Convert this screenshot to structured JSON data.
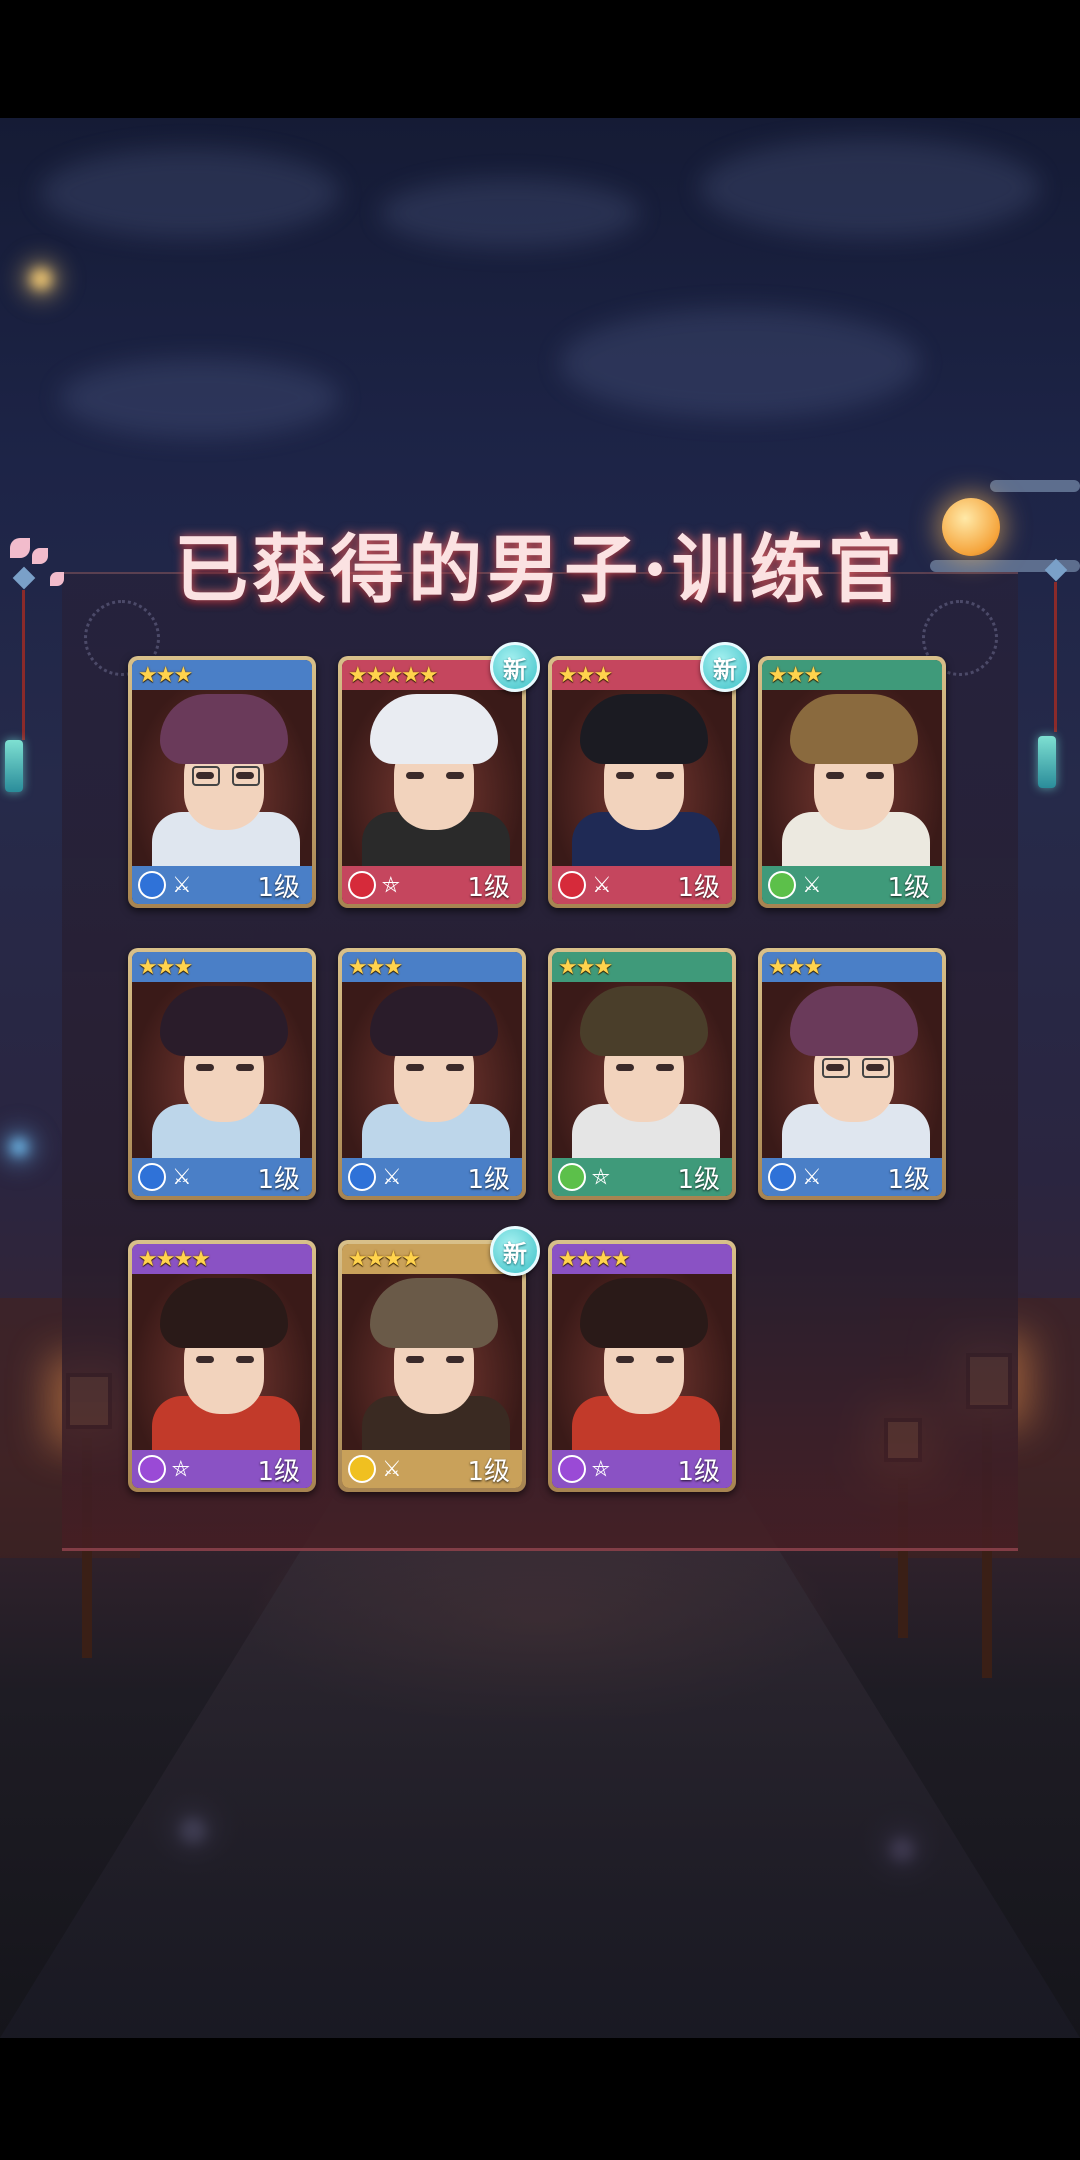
{
  "title": "已获得的男子·训练官",
  "new_badge_label": "新",
  "colors": {
    "blue": "#4a7fc7",
    "red": "#c5465e",
    "green": "#3f9a7a",
    "purple": "#8a52c4",
    "gold": "#c9a15a"
  },
  "cards": [
    {
      "stars": "★★★",
      "level": "1级",
      "frame": "blue",
      "attribute_icon": "water-orb-icon",
      "type_icon": "crossed-swords-icon",
      "is_new": false
    },
    {
      "stars": "★★★★★",
      "level": "1级",
      "frame": "red",
      "attribute_icon": "fire-drop-icon",
      "type_icon": "pentagram-icon",
      "is_new": true
    },
    {
      "stars": "★★★",
      "level": "1级",
      "frame": "red",
      "attribute_icon": "fire-drop-icon",
      "type_icon": "crossed-swords-icon",
      "is_new": true
    },
    {
      "stars": "★★★",
      "level": "1级",
      "frame": "green",
      "attribute_icon": "leaf-icon",
      "type_icon": "crossed-swords-icon",
      "is_new": false
    },
    {
      "stars": "★★★",
      "level": "1级",
      "frame": "blue",
      "attribute_icon": "water-orb-icon",
      "type_icon": "crossed-swords-icon",
      "is_new": false
    },
    {
      "stars": "★★★",
      "level": "1级",
      "frame": "blue",
      "attribute_icon": "water-orb-icon",
      "type_icon": "crossed-swords-icon",
      "is_new": false
    },
    {
      "stars": "★★★",
      "level": "1级",
      "frame": "green",
      "attribute_icon": "leaf-icon",
      "type_icon": "pentagram-icon",
      "is_new": false
    },
    {
      "stars": "★★★",
      "level": "1级",
      "frame": "blue",
      "attribute_icon": "water-orb-icon",
      "type_icon": "crossed-swords-icon",
      "is_new": false
    },
    {
      "stars": "★★★★",
      "level": "1级",
      "frame": "purple",
      "attribute_icon": "wind-swirl-icon",
      "type_icon": "pentagram-icon",
      "is_new": false
    },
    {
      "stars": "★★★★",
      "level": "1级",
      "frame": "gold",
      "attribute_icon": "star-diamond-icon",
      "type_icon": "crossed-swords-icon",
      "is_new": true
    },
    {
      "stars": "★★★★",
      "level": "1级",
      "frame": "purple",
      "attribute_icon": "wind-swirl-icon",
      "type_icon": "pentagram-icon",
      "is_new": false
    }
  ]
}
